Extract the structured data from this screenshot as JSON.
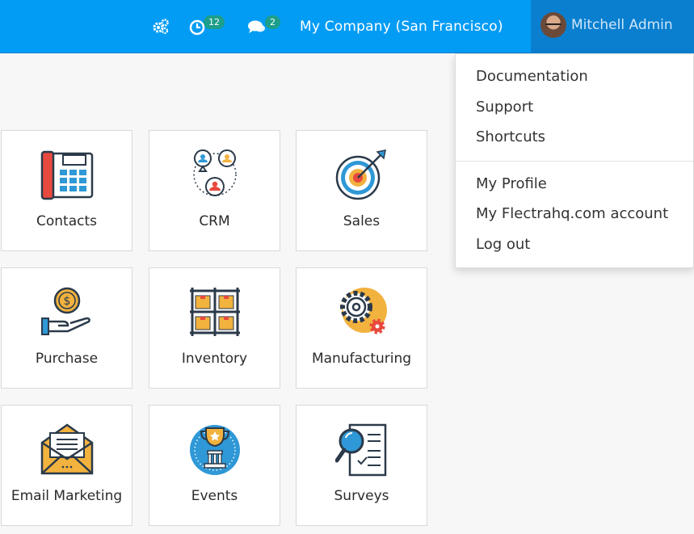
{
  "topbar": {
    "activity_badge": "12",
    "messages_badge": "2",
    "company": "My Company (San Francisco)",
    "user_name": "Mitchell Admin",
    "bar_color": "#039cf5"
  },
  "user_menu": {
    "items_top": [
      "Documentation",
      "Support",
      "Shortcuts"
    ],
    "items_bottom": [
      "My Profile",
      "My Flectrahq.com account",
      "Log out"
    ]
  },
  "apps": [
    {
      "label": "Contacts",
      "icon": "contacts-phone-icon"
    },
    {
      "label": "CRM",
      "icon": "crm-people-icon"
    },
    {
      "label": "Sales",
      "icon": "sales-target-icon"
    },
    {
      "label": "Purchase",
      "icon": "purchase-hand-coin-icon"
    },
    {
      "label": "Inventory",
      "icon": "inventory-shelf-icon"
    },
    {
      "label": "Manufacturing",
      "icon": "manufacturing-gears-icon"
    },
    {
      "label": "Email Marketing",
      "icon": "email-envelope-icon"
    },
    {
      "label": "Events",
      "icon": "events-trophy-icon"
    },
    {
      "label": "Surveys",
      "icon": "surveys-clipboard-icon"
    }
  ]
}
